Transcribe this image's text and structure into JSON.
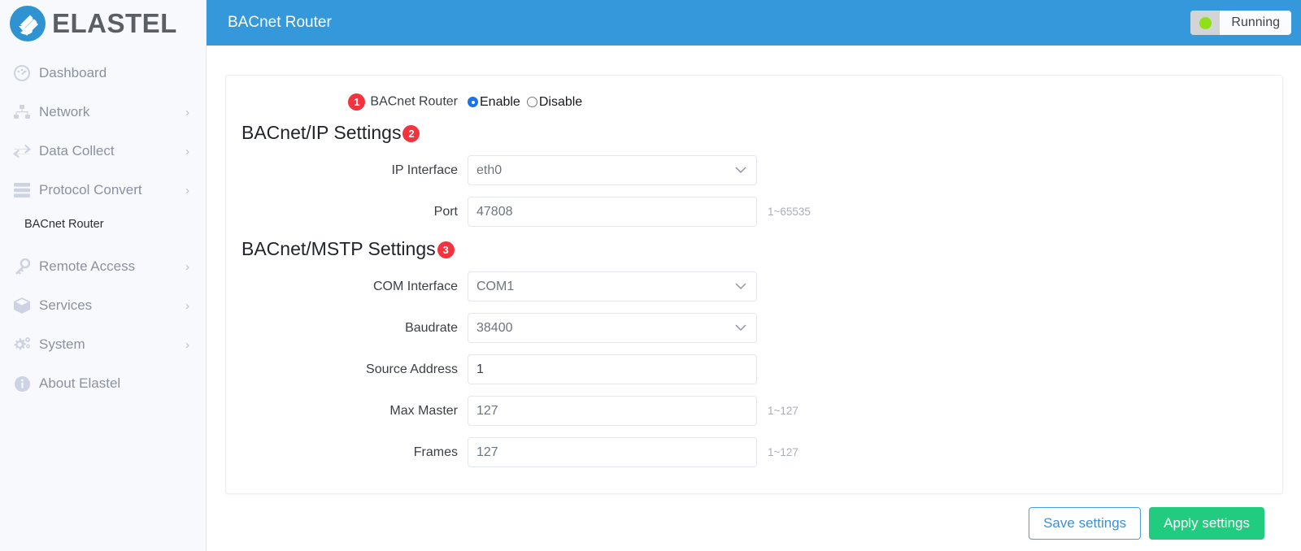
{
  "brand": {
    "name": "ELASTEL",
    "logo_icon": "elastel-logo-icon",
    "logo_color": "#2f93d1"
  },
  "sidebar": {
    "items": [
      {
        "label": "Dashboard",
        "icon": "dashboard-gauge-icon",
        "has_caret": false
      },
      {
        "label": "Network",
        "icon": "network-nodes-icon",
        "has_caret": true,
        "caret": "›"
      },
      {
        "label": "Data Collect",
        "icon": "data-exchange-arrows-icon",
        "has_caret": true,
        "caret": "›"
      },
      {
        "label": "Protocol Convert",
        "icon": "server-stack-icon",
        "has_caret": true,
        "caret": "›"
      },
      {
        "label": "Remote Access",
        "icon": "key-icon",
        "has_caret": true,
        "caret": "›"
      },
      {
        "label": "Services",
        "icon": "box-cube-icon",
        "has_caret": true,
        "caret": "›"
      },
      {
        "label": "System",
        "icon": "gears-icon",
        "has_caret": true,
        "caret": "›"
      },
      {
        "label": "About Elastel",
        "icon": "info-circle-icon",
        "has_caret": false
      }
    ],
    "submenu": {
      "label": "BACnet Router",
      "parent": "Protocol Convert",
      "active": true
    }
  },
  "topbar": {
    "title": "BACnet Router",
    "status": {
      "text": "Running",
      "dot_color": "#8fe016",
      "dot_icon": "status-dot-icon"
    }
  },
  "form": {
    "enable_row": {
      "badge": "1",
      "label": "BACnet Router",
      "options": [
        {
          "label": "Enable",
          "selected": true
        },
        {
          "label": "Disable",
          "selected": false
        }
      ]
    },
    "sections": [
      {
        "title": "BACnet/IP Settings",
        "badge": "2",
        "fields": [
          {
            "label": "IP Interface",
            "value": "eth0",
            "type": "select",
            "filled": false,
            "hint": "",
            "chevron": "chevron-down-icon"
          },
          {
            "label": "Port",
            "value": "47808",
            "type": "text",
            "filled": false,
            "hint": "1~65535"
          }
        ]
      },
      {
        "title": "BACnet/MSTP Settings",
        "badge": "3",
        "fields": [
          {
            "label": "COM Interface",
            "value": "COM1",
            "type": "select",
            "filled": false,
            "hint": "",
            "chevron": "chevron-down-icon"
          },
          {
            "label": "Baudrate",
            "value": "38400",
            "type": "select",
            "filled": false,
            "hint": "",
            "chevron": "chevron-down-icon"
          },
          {
            "label": "Source Address",
            "value": "1",
            "type": "text",
            "filled": true,
            "hint": ""
          },
          {
            "label": "Max Master",
            "value": "127",
            "type": "text",
            "filled": false,
            "hint": "1~127"
          },
          {
            "label": "Frames",
            "value": "127",
            "type": "text",
            "filled": false,
            "hint": "1~127"
          }
        ]
      }
    ]
  },
  "actions": {
    "save_label": "Save settings",
    "apply_label": "Apply settings",
    "primary_color": "#21cb7f",
    "outline_color": "#3d8fd6"
  }
}
